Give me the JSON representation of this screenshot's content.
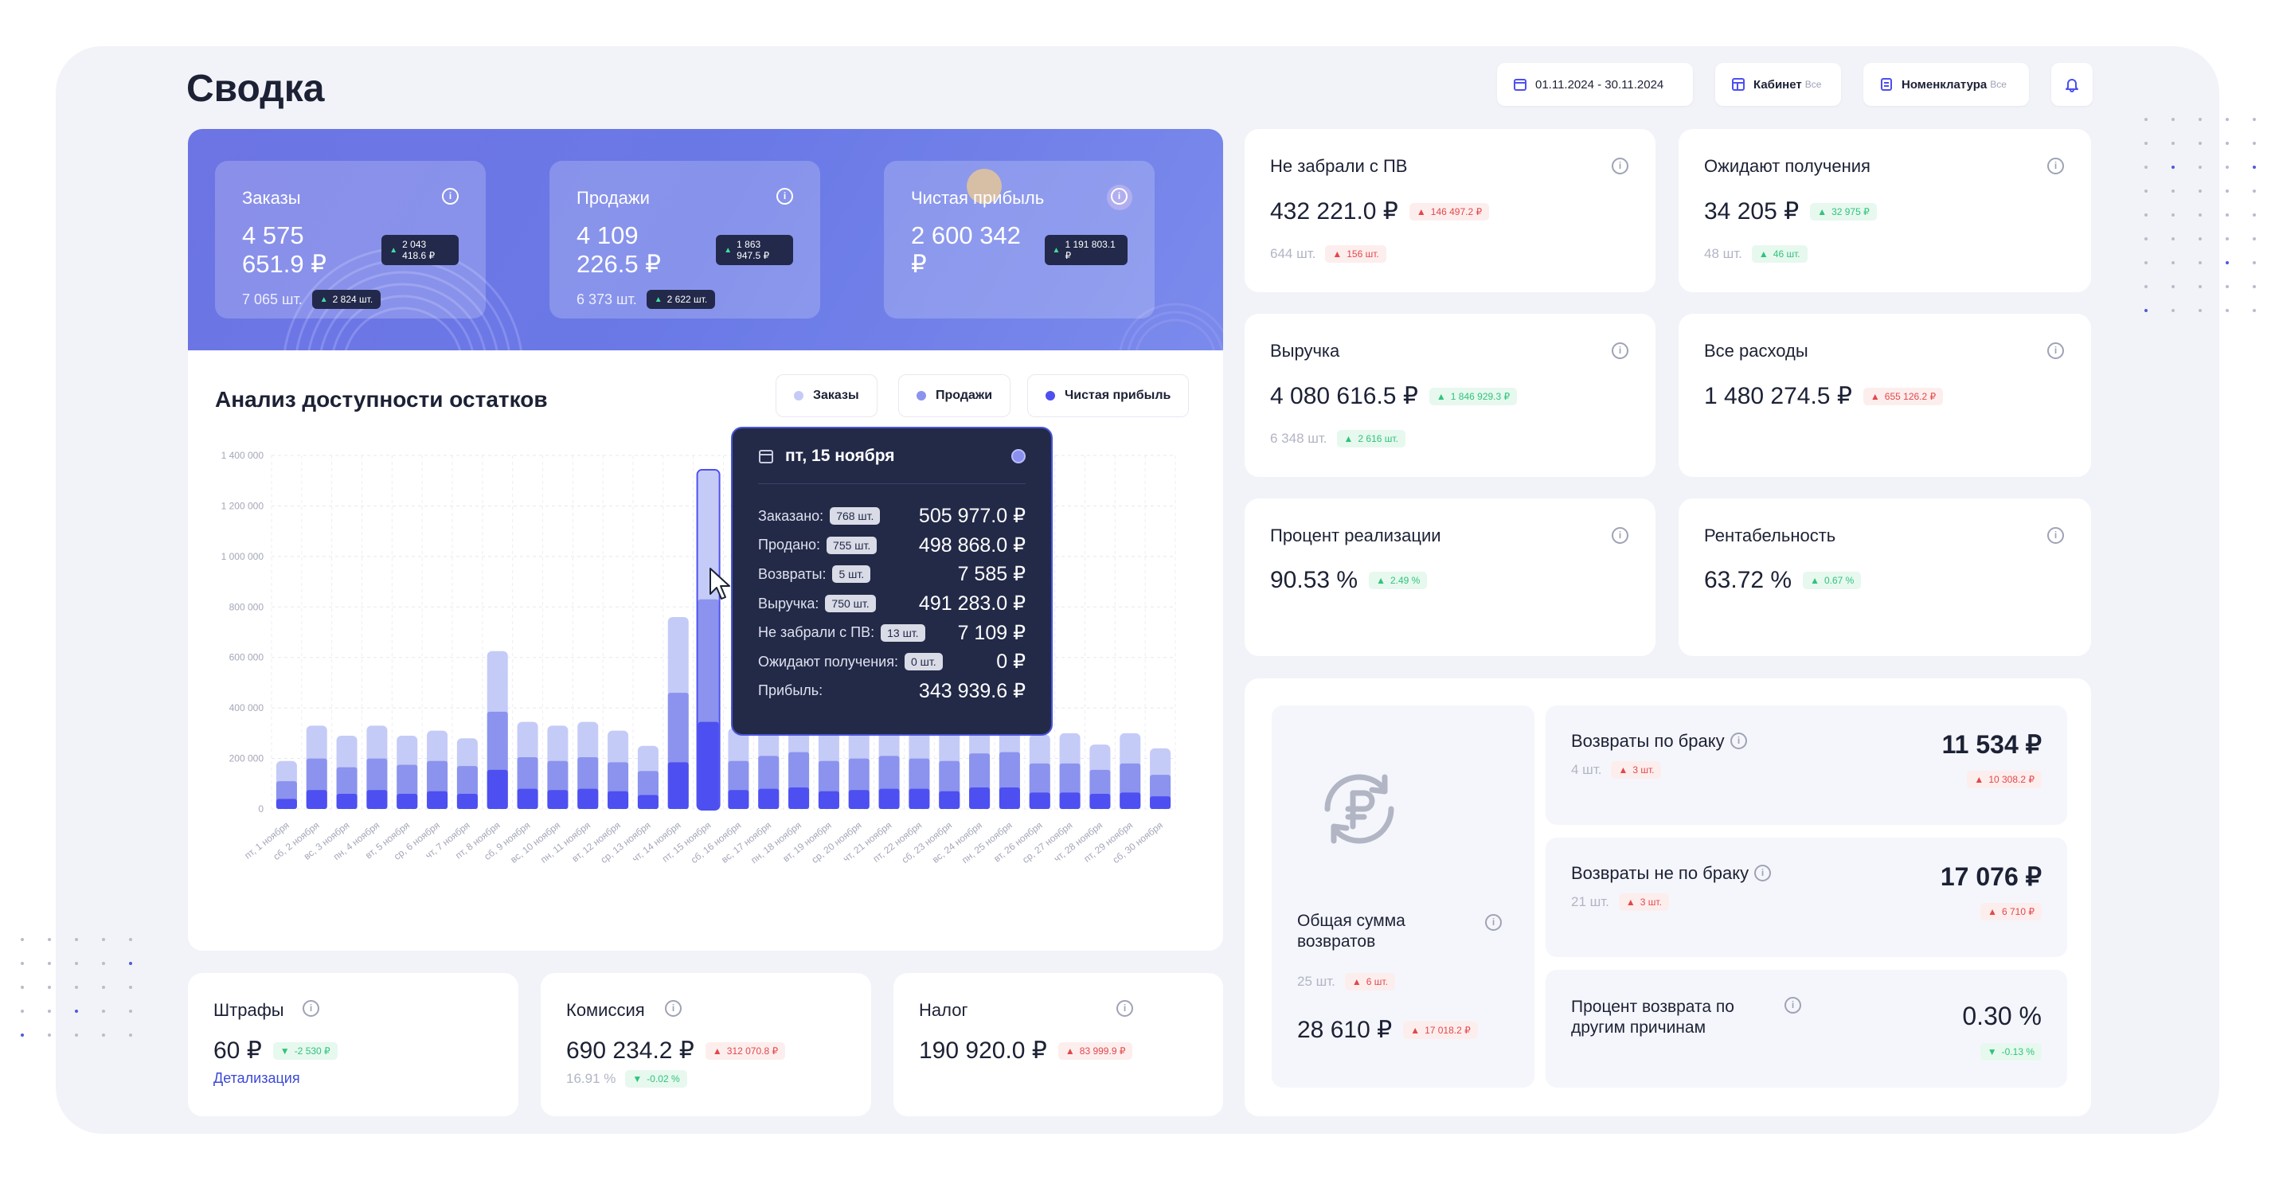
{
  "page": {
    "title": "Сводка"
  },
  "header": {
    "date_range": "01.11.2024 - 30.11.2024",
    "cabinet_label": "Кабинет",
    "cabinet_value": "Все",
    "nomenclature_label": "Номенклатура",
    "nomenclature_value": "Все"
  },
  "hero": {
    "orders": {
      "label": "Заказы",
      "value": "4 575 651.9 ₽",
      "delta": "2 043 418.6 ₽",
      "count": "7 065 шт.",
      "count_delta": "2 824 шт."
    },
    "sales": {
      "label": "Продажи",
      "value": "4 109 226.5 ₽",
      "delta": "1 863 947.5 ₽",
      "count": "6 373 шт.",
      "count_delta": "2 622 шт."
    },
    "profit": {
      "label": "Чистая прибыль",
      "value": "2 600 342 ₽",
      "delta": "1 191 803.1 ₽"
    }
  },
  "kpis": {
    "not_picked": {
      "label": "Не забрали с ПВ",
      "value": "432 221.0 ₽",
      "delta": "146 497.2 ₽",
      "count": "644 шт.",
      "count_delta": "156 шт."
    },
    "awaiting": {
      "label": "Ожидают получения",
      "value": "34 205 ₽",
      "delta": "32 975 ₽",
      "count": "48 шт.",
      "count_delta": "46 шт."
    },
    "revenue": {
      "label": "Выручка",
      "value": "4 080 616.5 ₽",
      "delta": "1 846 929.3 ₽",
      "count": "6 348 шт.",
      "count_delta": "2 616 шт."
    },
    "expenses": {
      "label": "Все расходы",
      "value": "1 480 274.5 ₽",
      "delta": "655 126.2 ₽"
    },
    "realization": {
      "label": "Процент реализации",
      "value": "90.53 %",
      "delta": "2.49 %"
    },
    "profitability": {
      "label": "Рентабельность",
      "value": "63.72 %",
      "delta": "0.67 %"
    }
  },
  "chart_section": {
    "title": "Анализ доступности остатков",
    "legend": [
      "Заказы",
      "Продажи",
      "Чистая прибыль"
    ]
  },
  "chart_data": {
    "type": "bar",
    "categories": [
      "пт, 1 ноября",
      "сб, 2 ноября",
      "вс, 3 ноября",
      "пн, 4 ноября",
      "вт, 5 ноября",
      "ср, 6 ноября",
      "чт, 7 ноября",
      "пт, 8 ноября",
      "сб, 9 ноября",
      "вс, 10 ноября",
      "пн, 11 ноября",
      "вт, 12 ноября",
      "ср, 13 ноября",
      "чт, 14 ноября",
      "пт, 15 ноября",
      "сб, 16 ноября",
      "вс, 17 ноября",
      "пн, 18 ноября",
      "вт, 19 ноября",
      "ср, 20 ноября",
      "чт, 21 ноября",
      "пт, 22 ноября",
      "сб, 23 ноября",
      "вс, 24 ноября",
      "пн, 25 ноября",
      "вт, 26 ноября",
      "ср, 27 ноября",
      "чт, 28 ноября",
      "пт, 29 ноября",
      "сб, 30 ноября"
    ],
    "series": [
      {
        "name": "Заказы",
        "color": "#c5cbf7",
        "values": [
          190000,
          330000,
          290000,
          330000,
          290000,
          310000,
          280000,
          625000,
          345000,
          330000,
          345000,
          310000,
          250000,
          760000,
          1340000,
          320000,
          350000,
          395000,
          320000,
          330000,
          350000,
          335000,
          315000,
          370000,
          380000,
          295000,
          300000,
          255000,
          300000,
          240000
        ]
      },
      {
        "name": "Продажи",
        "color": "#8b93ee",
        "values": [
          110000,
          200000,
          165000,
          200000,
          175000,
          190000,
          170000,
          385000,
          205000,
          190000,
          205000,
          185000,
          150000,
          460000,
          830000,
          190000,
          210000,
          225000,
          190000,
          200000,
          210000,
          200000,
          190000,
          220000,
          225000,
          180000,
          180000,
          155000,
          180000,
          135000
        ]
      },
      {
        "name": "Чистая прибыль",
        "color": "#4d4ff0",
        "values": [
          40000,
          75000,
          60000,
          75000,
          60000,
          70000,
          60000,
          155000,
          80000,
          75000,
          80000,
          70000,
          55000,
          185000,
          345000,
          75000,
          80000,
          85000,
          70000,
          75000,
          80000,
          80000,
          70000,
          85000,
          85000,
          65000,
          65000,
          60000,
          65000,
          50000
        ]
      }
    ],
    "y_ticks": [
      "0",
      "200 000",
      "400 000",
      "600 000",
      "800 000",
      "1 000 000",
      "1 200 000",
      "1 400 000"
    ],
    "ylim": [
      0,
      1400000
    ],
    "grid": true,
    "highlight_index": 14
  },
  "tooltip": {
    "date": "пт, 15 ноября",
    "rows": [
      {
        "label": "Заказано:",
        "qty": "768 шт.",
        "value": "505 977.0 ₽"
      },
      {
        "label": "Продано:",
        "qty": "755 шт.",
        "value": "498 868.0 ₽"
      },
      {
        "label": "Возвраты:",
        "qty": "5 шт.",
        "value": "7 585 ₽"
      },
      {
        "label": "Выручка:",
        "qty": "750 шт.",
        "value": "491 283.0 ₽"
      },
      {
        "label": "Не забрали с ПВ:",
        "qty": "13 шт.",
        "value": "7 109 ₽"
      },
      {
        "label": "Ожидают получения:",
        "qty": "0 шт.",
        "value": "0 ₽"
      },
      {
        "label": "Прибыль:",
        "qty": "",
        "value": "343 939.6 ₽"
      }
    ]
  },
  "bottom": {
    "fines": {
      "label": "Штрафы",
      "value": "60 ₽",
      "delta": "-2 530 ₽",
      "link": "Детализация"
    },
    "commission": {
      "label": "Комиссия",
      "value": "690 234.2 ₽",
      "delta": "312 070.8 ₽",
      "pct": "16.91 %",
      "pct_delta": "-0.02 %"
    },
    "tax": {
      "label": "Налог",
      "value": "190 920.0 ₽",
      "delta": "83 999.9 ₽"
    }
  },
  "returns": {
    "total": {
      "label": "Общая сумма возвратов",
      "count": "25 шт.",
      "count_delta": "6 шт.",
      "value": "28 610 ₽",
      "delta": "17 018.2 ₽"
    },
    "defect": {
      "label": "Возвраты по браку",
      "count": "4 шт.",
      "count_delta": "3 шт.",
      "value": "11 534 ₽",
      "delta": "10 308.2 ₽"
    },
    "non_defect": {
      "label": "Возвраты не по браку",
      "count": "21 шт.",
      "count_delta": "3 шт.",
      "value": "17 076 ₽",
      "delta": "6 710 ₽"
    },
    "other_pct": {
      "label": "Процент возврата по другим причинам",
      "value": "0.30 %",
      "delta": "-0.13 %"
    }
  },
  "colors": {
    "accent": "#4d4ff0",
    "dark": "#23294a",
    "positive": "#2fc47a",
    "negative": "#e2484a"
  }
}
